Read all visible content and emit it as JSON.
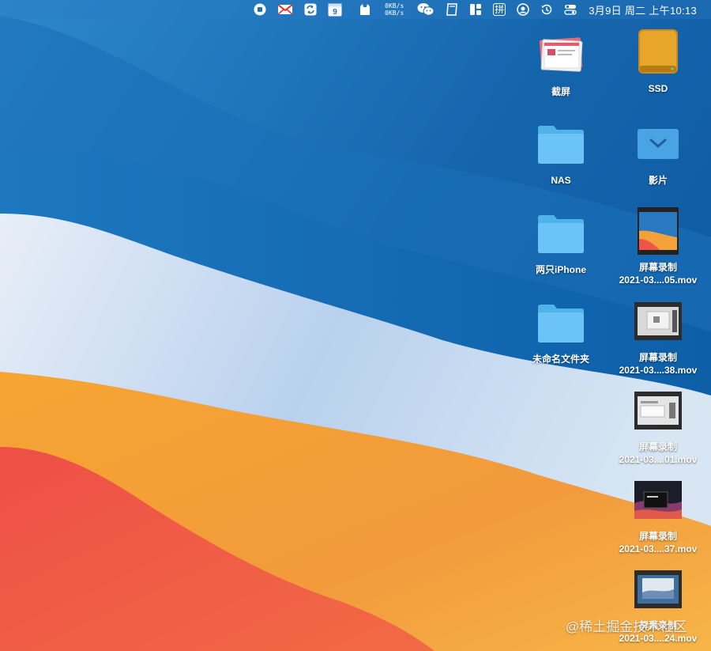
{
  "menubar": {
    "icons": [
      "stop-circle-icon",
      "mail-icon",
      "sync-icon",
      "calendar-icon",
      "cat-icon",
      "network-speed",
      "wechat-icon",
      "notes-icon",
      "layout-icon",
      "input-method-icon",
      "user-circle-icon",
      "time-machine-icon",
      "control-center-icon"
    ],
    "calendar_day": "9",
    "net_up": "0KB/s",
    "net_down": "0KB/s",
    "input_method": "拼",
    "clock": "3月9日 周二 上午10:13"
  },
  "desktop": {
    "items": [
      {
        "label": "截屏",
        "icon": "screenshot-stack-icon"
      },
      {
        "label": "SSD",
        "icon": "external-drive-icon"
      },
      {
        "label": "NAS",
        "icon": "folder-icon"
      },
      {
        "label": "影片",
        "icon": "download-folder-icon"
      },
      {
        "label": "两只iPhone",
        "icon": "folder-icon"
      },
      {
        "label": "屏幕录制",
        "sublabel": "2021-03....05.mov",
        "icon": "video-thumbnail-icon"
      },
      {
        "label": "未命名文件夹",
        "icon": "folder-icon"
      },
      {
        "label": "屏幕录制",
        "sublabel": "2021-03....38.mov",
        "icon": "video-thumbnail-icon"
      },
      {
        "label": "屏幕录制",
        "sublabel": "2021-03....01.mov",
        "icon": "video-thumbnail-icon"
      },
      {
        "label": "屏幕录制",
        "sublabel": "2021-03....37.mov",
        "icon": "video-thumbnail-icon"
      },
      {
        "label": "屏幕录制",
        "sublabel": "2021-03....24.mov",
        "icon": "video-thumbnail-icon"
      }
    ]
  },
  "watermark": "@稀土掘金技术社区",
  "colors": {
    "sky_top": "#1f72b9",
    "wave_light": "#c9dcef",
    "orange": "#f4a23a",
    "red": "#ef5a47",
    "folder": "#6cc3f5"
  }
}
